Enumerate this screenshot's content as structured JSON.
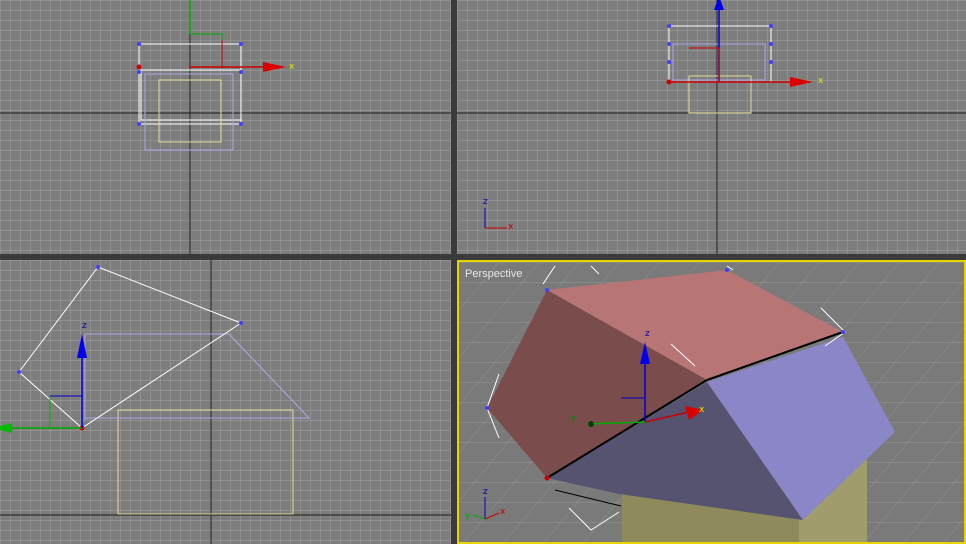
{
  "viewports": {
    "top": {
      "label": ""
    },
    "front": {
      "label": ""
    },
    "left": {
      "label": ""
    },
    "perspective": {
      "label": "Perspective"
    }
  },
  "axes": {
    "x": "x",
    "y": "y",
    "z": "z"
  },
  "colors": {
    "viewport_bg": "#7d7d7d",
    "grid": "#9a9a9a",
    "active_border": "#e8d200",
    "roof_front_face": "#b87575",
    "roof_side_face": "#8a86c8",
    "box_face": "#8e8a5c",
    "gizmo_x": "#cc0000",
    "gizmo_y": "#00aa00",
    "gizmo_z": "#0000cc"
  }
}
